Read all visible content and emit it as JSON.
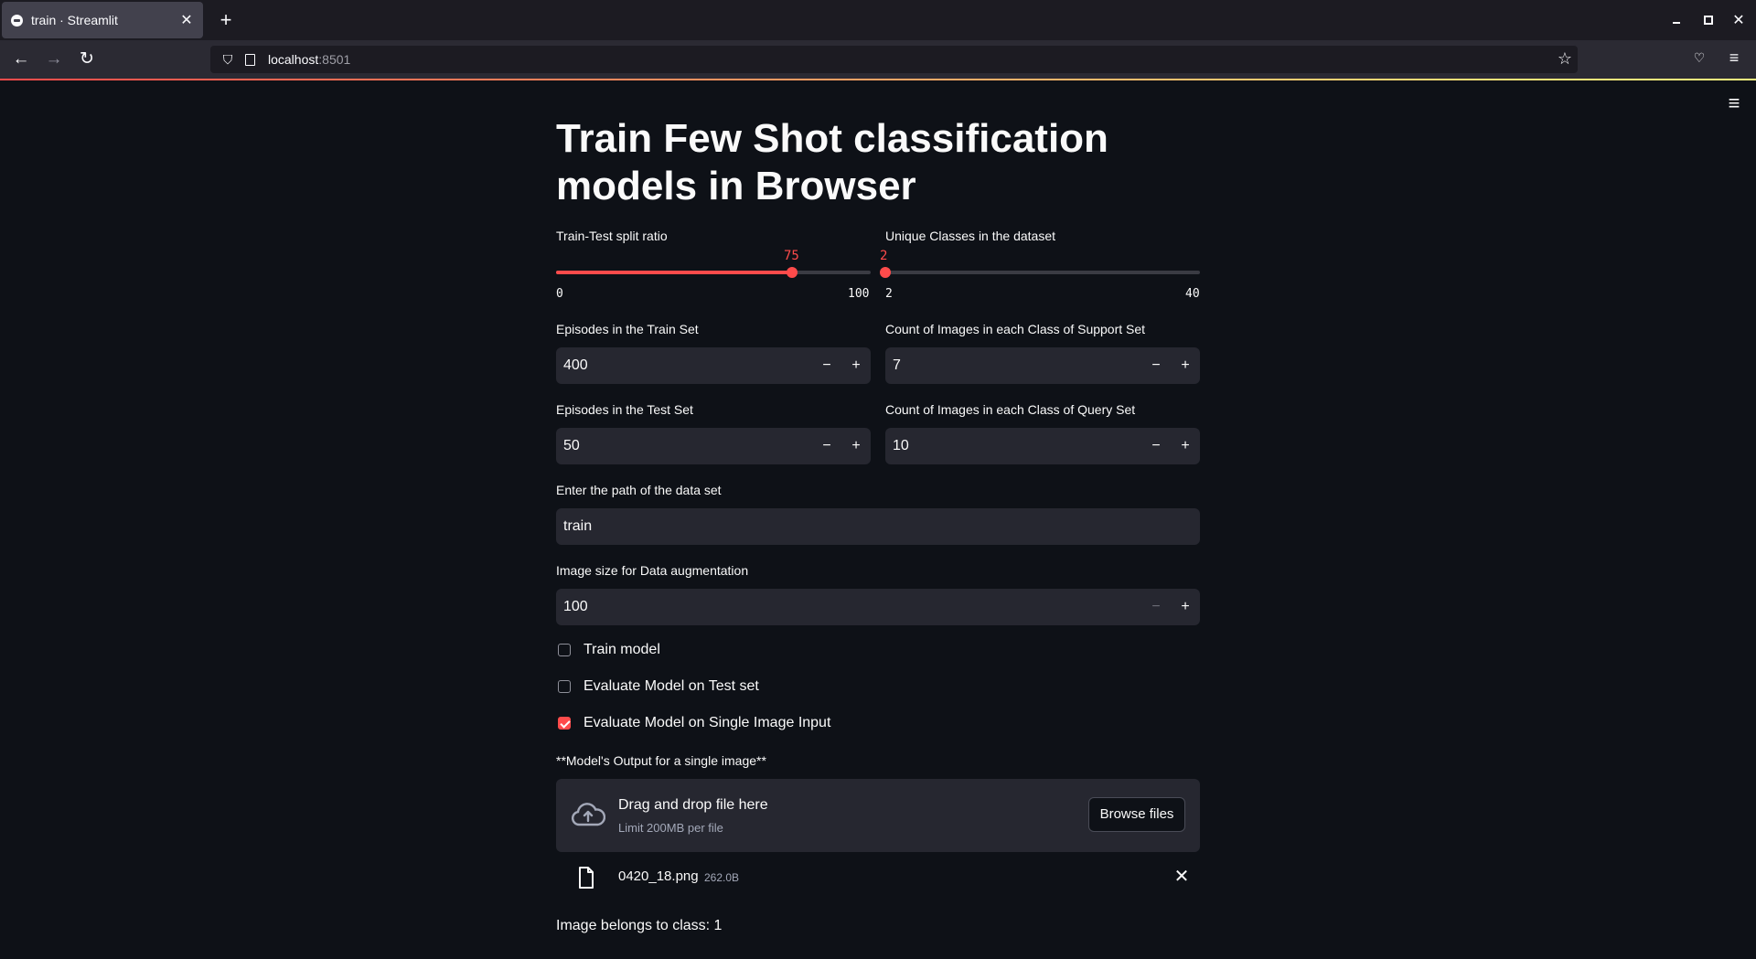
{
  "browser": {
    "tab_title": "train · Streamlit",
    "tab_close": "✕",
    "new_tab": "+",
    "url_host": "localhost",
    "url_port": ":8501"
  },
  "page": {
    "title": "Train Few Shot classification models in Browser"
  },
  "sliders": [
    {
      "label": "Train-Test split ratio",
      "value": "75",
      "min": "0",
      "max": "100",
      "fraction": 0.75
    },
    {
      "label": "Unique Classes in the dataset",
      "value": "2",
      "min": "2",
      "max": "40",
      "fraction": 0.0
    }
  ],
  "number_inputs": {
    "train_episodes": {
      "label": "Episodes in the Train Set",
      "value": "400"
    },
    "support_count": {
      "label": "Count of Images in each Class of Support Set",
      "value": "7"
    },
    "test_episodes": {
      "label": "Episodes in the Test Set",
      "value": "50"
    },
    "query_count": {
      "label": "Count of Images in each Class of Query Set",
      "value": "10"
    },
    "image_size": {
      "label": "Image size for Data augmentation",
      "value": "100"
    },
    "minus": "−",
    "plus": "+"
  },
  "dataset_path": {
    "label": "Enter the path of the data set",
    "value": "train"
  },
  "checkboxes": [
    {
      "label": "Train model",
      "checked": false
    },
    {
      "label": "Evaluate Model on Test set",
      "checked": false
    },
    {
      "label": "Evaluate Model on Single Image Input",
      "checked": true
    }
  ],
  "uploader": {
    "label": "**Model's Output for a single image**",
    "drop_text": "Drag and drop file here",
    "limit_text": "Limit 200MB per file",
    "browse_label": "Browse files",
    "file_name": "0420_18.png",
    "file_size": "262.0B",
    "remove": "✕"
  },
  "result_text": "Image belongs to class: 1",
  "colors": {
    "accent": "#ff4b4b",
    "background": "#0e1117",
    "input_bg": "#262730"
  }
}
